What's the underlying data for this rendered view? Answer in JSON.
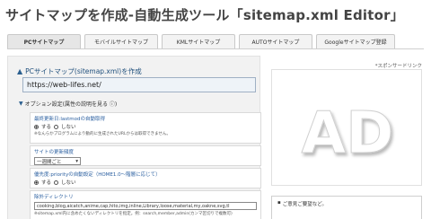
{
  "page": {
    "title": "サイトマップを作成-自動生成ツール「sitemap.xml Editor」"
  },
  "tabs": [
    {
      "label": "PCサイトマップ"
    },
    {
      "label": "モバイルサイトマップ"
    },
    {
      "label": "KMLサイトマップ"
    },
    {
      "label": "AUTOサイトマップ"
    },
    {
      "label": "Googleサイトマップ登録"
    }
  ],
  "main": {
    "title": "PCサイトマップ(sitemap.xml)を作成",
    "url_value": "https://web-lifes.net/",
    "options_heading": "オプション設定(属性の説明を見る ⓘ)",
    "lastmod": {
      "title": "最終更新日:lastmodの自動取得",
      "yes": "する",
      "no": "しない",
      "note": "※なんらかプログラムにより動的に生成されたURLからは取得できません。"
    },
    "changefreq": {
      "title": "サイトの更新頻度",
      "selected": "一週間ごと"
    },
    "priority": {
      "title": "優先度:priorityの自動設定（HOME1.0〜階層に応じて）",
      "yes": "する",
      "no": "しない"
    },
    "exclude": {
      "title": "除外ディレクトリ",
      "value": "cooking,blog,aicatch,anime,cap,hito,img,inline,Library,loose,material,my,oakne,svg,tl",
      "note": "※sitemap.xml内に含めたくないディレクトリを指定。例：search,member,admin(カンマ区切りで複数可)"
    }
  },
  "sidebar": {
    "sponsor_label": "*スポンサードリンク",
    "ad_text": "AD",
    "feedback_title": "ご意見ご要望など。"
  }
}
